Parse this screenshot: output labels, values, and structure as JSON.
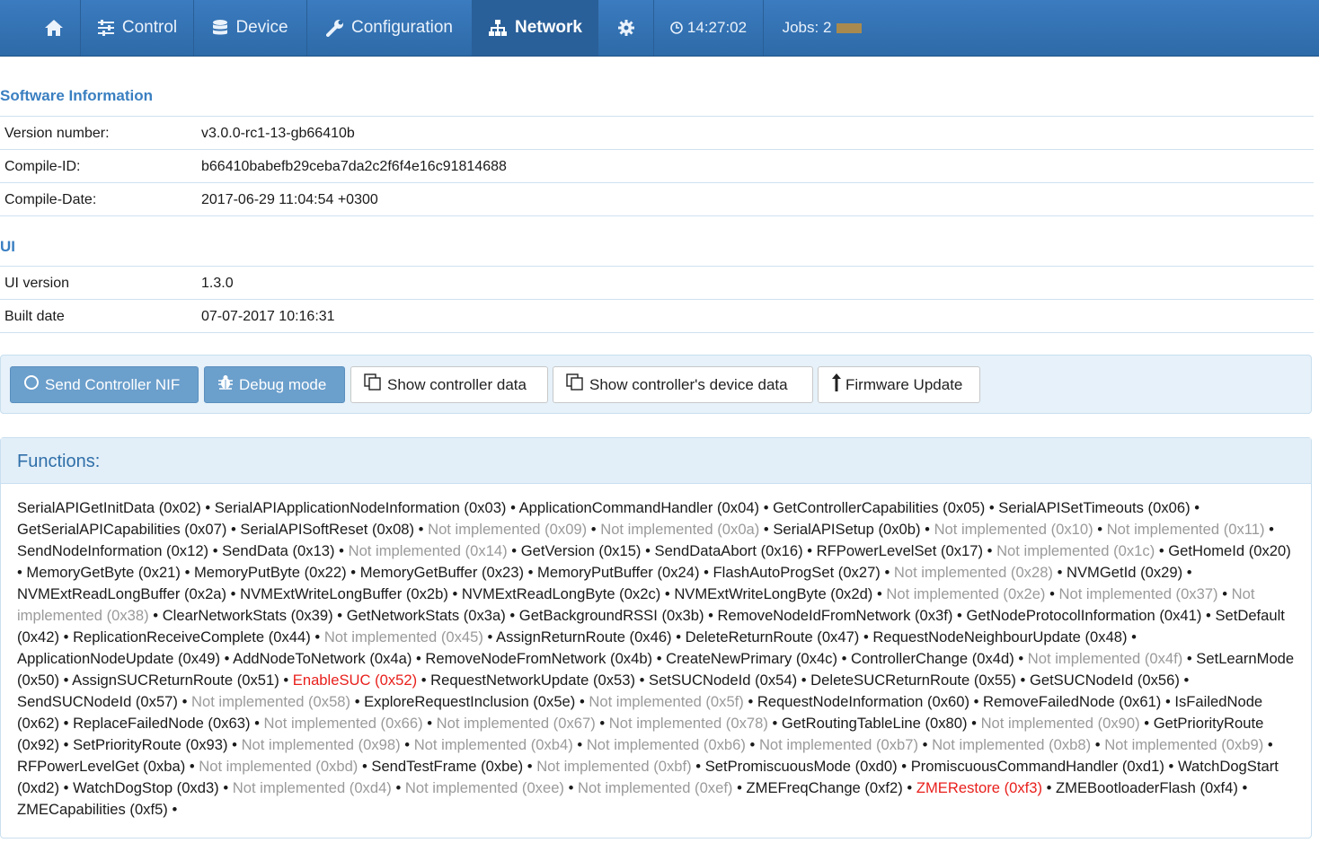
{
  "nav": {
    "control": "Control",
    "device": "Device",
    "configuration": "Configuration",
    "network": "Network",
    "time": "14:27:02",
    "jobs": "Jobs: 2"
  },
  "software": {
    "title": "Software Information",
    "rows": [
      {
        "label": "Version number:",
        "value": "v3.0.0-rc1-13-gb66410b"
      },
      {
        "label": "Compile-ID:",
        "value": "b66410babefb29ceba7da2c2f6f4e16c91814688"
      },
      {
        "label": "Compile-Date:",
        "value": "2017-06-29 11:04:54 +0300"
      }
    ]
  },
  "ui": {
    "title": "UI",
    "rows": [
      {
        "label": "UI version",
        "value": "1.3.0"
      },
      {
        "label": "Built date",
        "value": "07-07-2017 10:16:31"
      }
    ]
  },
  "buttons": {
    "send_nif": "Send Controller NIF",
    "debug": "Debug mode",
    "show_controller": "Show controller data",
    "show_device": "Show controller's device data",
    "firmware": "Firmware Update"
  },
  "functions": {
    "title": "Functions:",
    "items": [
      {
        "t": "SerialAPIGetInitData (0x02)",
        "s": "ok"
      },
      {
        "t": "SerialAPIApplicationNodeInformation (0x03)",
        "s": "ok"
      },
      {
        "t": "ApplicationCommandHandler (0x04)",
        "s": "ok"
      },
      {
        "t": "GetControllerCapabilities (0x05)",
        "s": "ok"
      },
      {
        "t": "SerialAPISetTimeouts (0x06)",
        "s": "ok"
      },
      {
        "t": "GetSerialAPICapabilities (0x07)",
        "s": "ok"
      },
      {
        "t": "SerialAPISoftReset (0x08)",
        "s": "ok"
      },
      {
        "t": "Not implemented (0x09)",
        "s": "ni"
      },
      {
        "t": "Not implemented (0x0a)",
        "s": "ni"
      },
      {
        "t": "SerialAPISetup (0x0b)",
        "s": "ok"
      },
      {
        "t": "Not implemented (0x10)",
        "s": "ni"
      },
      {
        "t": "Not implemented (0x11)",
        "s": "ni"
      },
      {
        "t": "SendNodeInformation (0x12)",
        "s": "ok"
      },
      {
        "t": "SendData (0x13)",
        "s": "ok"
      },
      {
        "t": "Not implemented (0x14)",
        "s": "ni"
      },
      {
        "t": "GetVersion (0x15)",
        "s": "ok"
      },
      {
        "t": "SendDataAbort (0x16)",
        "s": "ok"
      },
      {
        "t": "RFPowerLevelSet (0x17)",
        "s": "ok"
      },
      {
        "t": "Not implemented (0x1c)",
        "s": "ni"
      },
      {
        "t": "GetHomeId (0x20)",
        "s": "ok"
      },
      {
        "t": "MemoryGetByte (0x21)",
        "s": "ok"
      },
      {
        "t": "MemoryPutByte (0x22)",
        "s": "ok"
      },
      {
        "t": "MemoryGetBuffer (0x23)",
        "s": "ok"
      },
      {
        "t": "MemoryPutBuffer (0x24)",
        "s": "ok"
      },
      {
        "t": "FlashAutoProgSet (0x27)",
        "s": "ok"
      },
      {
        "t": "Not implemented (0x28)",
        "s": "ni"
      },
      {
        "t": "NVMGetId (0x29)",
        "s": "ok"
      },
      {
        "t": "NVMExtReadLongBuffer (0x2a)",
        "s": "ok"
      },
      {
        "t": "NVMExtWriteLongBuffer (0x2b)",
        "s": "ok"
      },
      {
        "t": "NVMExtReadLongByte (0x2c)",
        "s": "ok"
      },
      {
        "t": "NVMExtWriteLongByte (0x2d)",
        "s": "ok"
      },
      {
        "t": "Not implemented (0x2e)",
        "s": "ni"
      },
      {
        "t": "Not implemented (0x37)",
        "s": "ni"
      },
      {
        "t": "Not implemented (0x38)",
        "s": "ni"
      },
      {
        "t": "ClearNetworkStats (0x39)",
        "s": "ok"
      },
      {
        "t": "GetNetworkStats (0x3a)",
        "s": "ok"
      },
      {
        "t": "GetBackgroundRSSI (0x3b)",
        "s": "ok"
      },
      {
        "t": "RemoveNodeIdFromNetwork (0x3f)",
        "s": "ok"
      },
      {
        "t": "GetNodeProtocolInformation (0x41)",
        "s": "ok"
      },
      {
        "t": "SetDefault (0x42)",
        "s": "ok"
      },
      {
        "t": "ReplicationReceiveComplete (0x44)",
        "s": "ok"
      },
      {
        "t": "Not implemented (0x45)",
        "s": "ni"
      },
      {
        "t": "AssignReturnRoute (0x46)",
        "s": "ok"
      },
      {
        "t": "DeleteReturnRoute (0x47)",
        "s": "ok"
      },
      {
        "t": "RequestNodeNeighbourUpdate (0x48)",
        "s": "ok"
      },
      {
        "t": "ApplicationNodeUpdate (0x49)",
        "s": "ok"
      },
      {
        "t": "AddNodeToNetwork (0x4a)",
        "s": "ok"
      },
      {
        "t": "RemoveNodeFromNetwork (0x4b)",
        "s": "ok"
      },
      {
        "t": "CreateNewPrimary (0x4c)",
        "s": "ok"
      },
      {
        "t": "ControllerChange (0x4d)",
        "s": "ok"
      },
      {
        "t": "Not implemented (0x4f)",
        "s": "ni"
      },
      {
        "t": "SetLearnMode (0x50)",
        "s": "ok"
      },
      {
        "t": "AssignSUCReturnRoute (0x51)",
        "s": "ok"
      },
      {
        "t": "EnableSUC (0x52)",
        "s": "red"
      },
      {
        "t": "RequestNetworkUpdate (0x53)",
        "s": "ok"
      },
      {
        "t": "SetSUCNodeId (0x54)",
        "s": "ok"
      },
      {
        "t": "DeleteSUCReturnRoute (0x55)",
        "s": "ok"
      },
      {
        "t": "GetSUCNodeId (0x56)",
        "s": "ok"
      },
      {
        "t": "SendSUCNodeId (0x57)",
        "s": "ok"
      },
      {
        "t": "Not implemented (0x58)",
        "s": "ni"
      },
      {
        "t": "ExploreRequestInclusion (0x5e)",
        "s": "ok"
      },
      {
        "t": "Not implemented (0x5f)",
        "s": "ni"
      },
      {
        "t": "RequestNodeInformation (0x60)",
        "s": "ok"
      },
      {
        "t": "RemoveFailedNode (0x61)",
        "s": "ok"
      },
      {
        "t": "IsFailedNode (0x62)",
        "s": "ok"
      },
      {
        "t": "ReplaceFailedNode (0x63)",
        "s": "ok"
      },
      {
        "t": "Not implemented (0x66)",
        "s": "ni"
      },
      {
        "t": "Not implemented (0x67)",
        "s": "ni"
      },
      {
        "t": "Not implemented (0x78)",
        "s": "ni"
      },
      {
        "t": "GetRoutingTableLine (0x80)",
        "s": "ok"
      },
      {
        "t": "Not implemented (0x90)",
        "s": "ni"
      },
      {
        "t": "GetPriorityRoute (0x92)",
        "s": "ok"
      },
      {
        "t": "SetPriorityRoute (0x93)",
        "s": "ok"
      },
      {
        "t": "Not implemented (0x98)",
        "s": "ni"
      },
      {
        "t": "Not implemented (0xb4)",
        "s": "ni"
      },
      {
        "t": "Not implemented (0xb6)",
        "s": "ni"
      },
      {
        "t": "Not implemented (0xb7)",
        "s": "ni"
      },
      {
        "t": "Not implemented (0xb8)",
        "s": "ni"
      },
      {
        "t": "Not implemented (0xb9)",
        "s": "ni"
      },
      {
        "t": "RFPowerLevelGet (0xba)",
        "s": "ok"
      },
      {
        "t": "Not implemented (0xbd)",
        "s": "ni"
      },
      {
        "t": "SendTestFrame (0xbe)",
        "s": "ok"
      },
      {
        "t": "Not implemented (0xbf)",
        "s": "ni"
      },
      {
        "t": "SetPromiscuousMode (0xd0)",
        "s": "ok"
      },
      {
        "t": "PromiscuousCommandHandler (0xd1)",
        "s": "ok"
      },
      {
        "t": "WatchDogStart (0xd2)",
        "s": "ok"
      },
      {
        "t": "WatchDogStop (0xd3)",
        "s": "ok"
      },
      {
        "t": "Not implemented (0xd4)",
        "s": "ni"
      },
      {
        "t": "Not implemented (0xee)",
        "s": "ni"
      },
      {
        "t": "Not implemented (0xef)",
        "s": "ni"
      },
      {
        "t": "ZMEFreqChange (0xf2)",
        "s": "ok"
      },
      {
        "t": "ZMERestore (0xf3)",
        "s": "red"
      },
      {
        "t": "ZMEBootloaderFlash (0xf4)",
        "s": "ok"
      },
      {
        "t": "ZMECapabilities (0xf5)",
        "s": "ok"
      }
    ]
  }
}
